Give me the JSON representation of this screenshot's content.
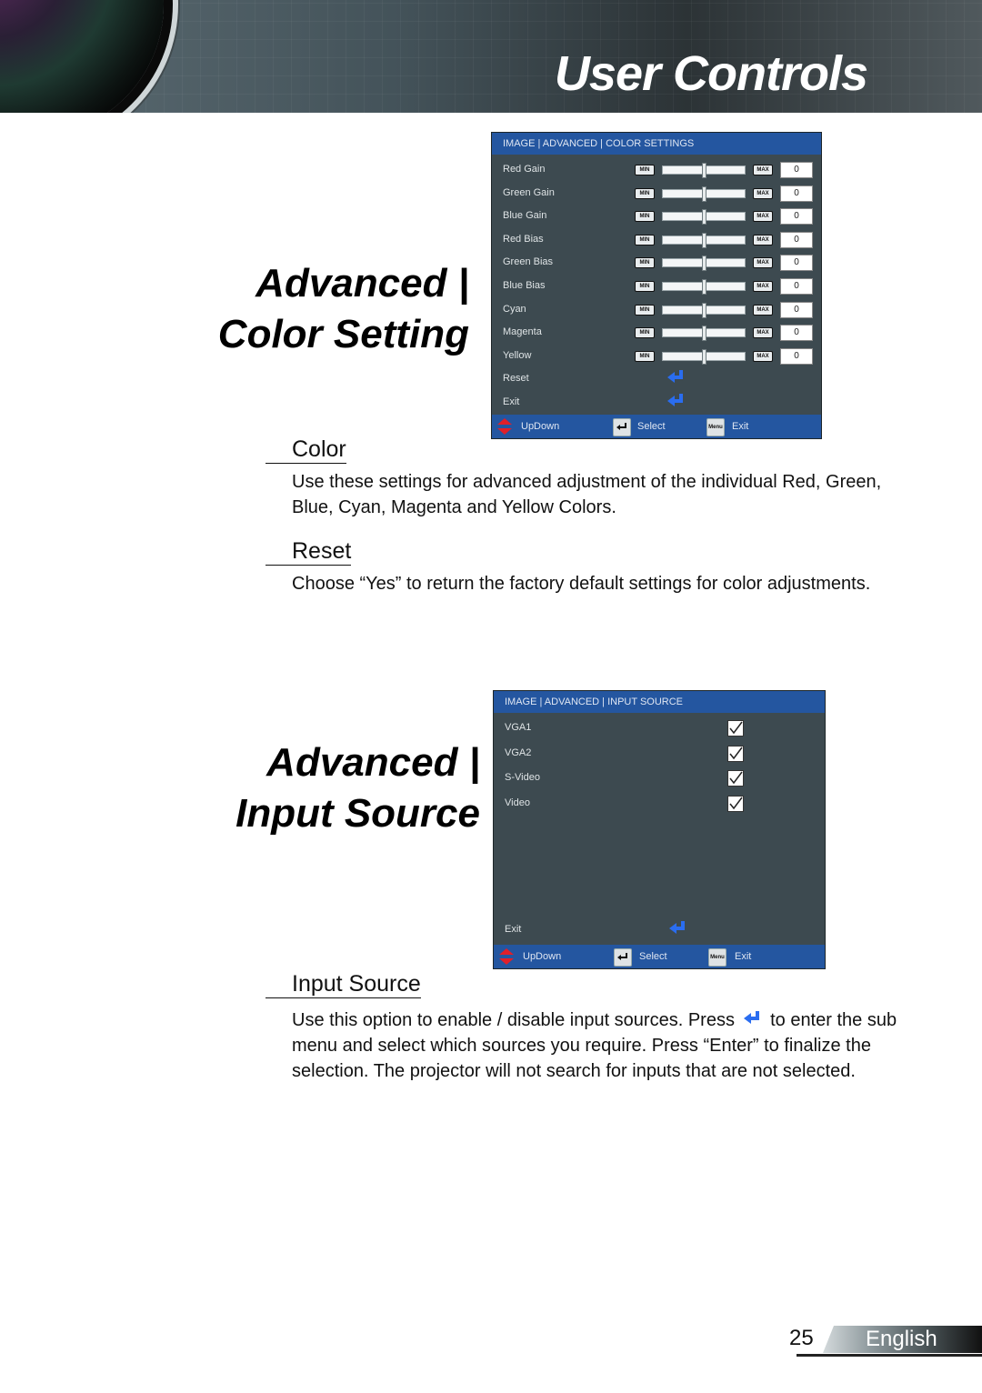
{
  "header": {
    "title": "User Controls"
  },
  "section1": {
    "title_line1": "Advanced |",
    "title_line2": "Color Setting",
    "osd": {
      "breadcrumb": "IMAGE | ADVANCED | COLOR SETTINGS",
      "min_label": "MIN",
      "max_label": "MAX",
      "sliders": [
        {
          "label": "Red Gain",
          "value": "0",
          "position": 0.5
        },
        {
          "label": "Green Gain",
          "value": "0",
          "position": 0.5
        },
        {
          "label": "Blue Gain",
          "value": "0",
          "position": 0.5
        },
        {
          "label": "Red Bias",
          "value": "0",
          "position": 0.5
        },
        {
          "label": "Green Bias",
          "value": "0",
          "position": 0.5
        },
        {
          "label": "Blue Bias",
          "value": "0",
          "position": 0.5
        },
        {
          "label": "Cyan",
          "value": "0",
          "position": 0.5
        },
        {
          "label": "Magenta",
          "value": "0",
          "position": 0.5
        },
        {
          "label": "Yellow",
          "value": "0",
          "position": 0.5
        }
      ],
      "actions": [
        {
          "label": "Reset",
          "icon": "enter-icon"
        },
        {
          "label": "Exit",
          "icon": "enter-icon"
        }
      ],
      "footer": {
        "updown": "UpDown",
        "select": "Select",
        "menu_key": "Menu",
        "exit": "Exit"
      }
    },
    "items": [
      {
        "heading": "Color",
        "text": "Use these settings for advanced adjustment of the individual Red, Green, Blue, Cyan, Magenta and Yellow Colors."
      },
      {
        "heading": "Reset",
        "text": "Choose “Yes” to return the factory default settings for color adjustments."
      }
    ]
  },
  "section2": {
    "title_line1": "Advanced |",
    "title_line2": "Input Source",
    "osd": {
      "breadcrumb": "IMAGE | ADVANCED | INPUT SOURCE",
      "sources": [
        {
          "label": "VGA1",
          "checked": true
        },
        {
          "label": "VGA2",
          "checked": true
        },
        {
          "label": "S-Video",
          "checked": true
        },
        {
          "label": "Video",
          "checked": true
        }
      ],
      "exit_label": "Exit",
      "footer": {
        "updown": "UpDown",
        "select": "Select",
        "menu_key": "Menu",
        "exit": "Exit"
      }
    },
    "item": {
      "heading": "Input Source",
      "text_before_icon": "Use this option to enable / disable input sources. Press",
      "text_after_icon": "to enter the sub menu and select which sources you require. Press “Enter” to finalize the selection. The projector will not search for inputs that are not selected."
    }
  },
  "footer": {
    "page_number": "25",
    "language": "English"
  },
  "colors": {
    "osd_bg": "#3d4a50",
    "osd_bar": "#2456a0",
    "enter_arrow": "#2a6df0",
    "updown_arrow": "#e0202a"
  }
}
